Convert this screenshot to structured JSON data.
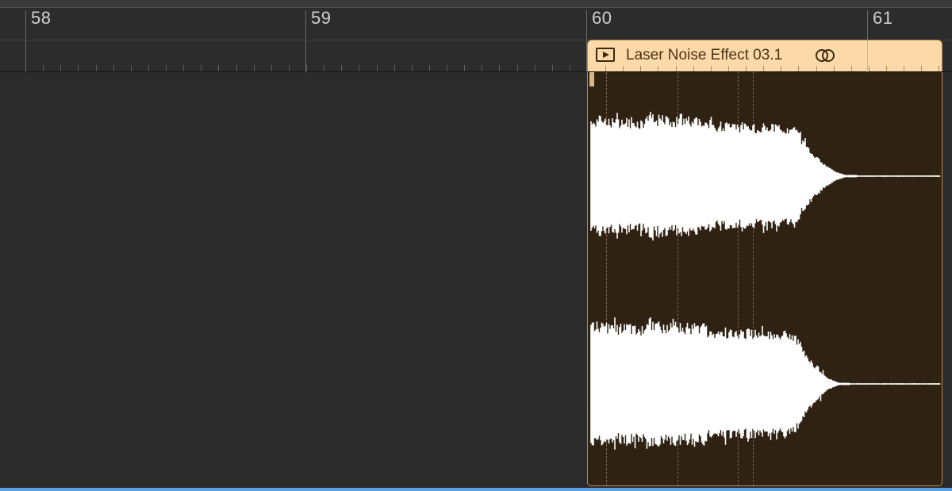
{
  "ruler": {
    "bars": [
      "58",
      "59",
      "60",
      "61"
    ]
  },
  "region": {
    "title": "Laser Noise Effect 03.1",
    "play_icon": "play-box-icon",
    "loop_icon": "loop-rings-icon",
    "header_color": "#fbd9a8",
    "body_color": "#2f2213",
    "waveform_color": "#ffffff"
  },
  "colors": {
    "background": "#2a2a2a",
    "selection_bar": "#5aa0de"
  }
}
